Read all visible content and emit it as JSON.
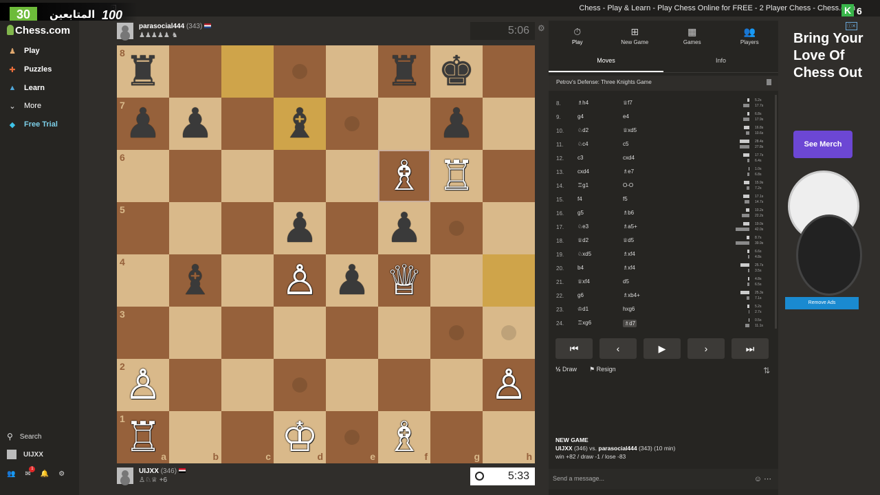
{
  "window": {
    "title": "Chess - Play & Learn - Play Chess Online for FREE - 2 Player Chess - Chess.com"
  },
  "overlay": {
    "count1": "30",
    "text": "المتابعين",
    "count2": "100",
    "k_label": "K",
    "k_num": "6"
  },
  "sidebar": {
    "logo": "Chess.com",
    "items": [
      {
        "label": "Play",
        "icon": "play-icon",
        "color": "#e2a96f"
      },
      {
        "label": "Puzzles",
        "icon": "puzzle-icon",
        "color": "#e86d3a"
      },
      {
        "label": "Learn",
        "icon": "learn-icon",
        "color": "#4fa6d8"
      },
      {
        "label": "More",
        "icon": "chevron-down-icon",
        "color": "#cccccc"
      },
      {
        "label": "Free Trial",
        "icon": "diamond-icon",
        "color": "#3ec3e8"
      }
    ],
    "search_label": "Search",
    "user_label": "UIJXX",
    "notif_count": "1"
  },
  "top_player": {
    "name": "parasocial444",
    "rating": "(343)",
    "material": "♟♟♟♟♟ ♞",
    "clock": "5:06"
  },
  "bottom_player": {
    "name": "UIJXX",
    "rating": "(346)",
    "material": "♙♘♕",
    "advantage": "+6",
    "clock": "5:33"
  },
  "board": {
    "files": [
      "a",
      "b",
      "c",
      "d",
      "e",
      "f",
      "g",
      "h"
    ],
    "ranks": [
      "8",
      "7",
      "6",
      "5",
      "4",
      "3",
      "2",
      "1"
    ],
    "pieces": [
      {
        "sq": "a8",
        "p": "♜",
        "c": "b"
      },
      {
        "sq": "f8",
        "p": "♜",
        "c": "b"
      },
      {
        "sq": "g8",
        "p": "♚",
        "c": "b"
      },
      {
        "sq": "a7",
        "p": "♟",
        "c": "b"
      },
      {
        "sq": "b7",
        "p": "♟",
        "c": "b"
      },
      {
        "sq": "d7",
        "p": "♝",
        "c": "b"
      },
      {
        "sq": "g7",
        "p": "♟",
        "c": "b"
      },
      {
        "sq": "f6",
        "p": "♗",
        "c": "w"
      },
      {
        "sq": "g6",
        "p": "♖",
        "c": "w"
      },
      {
        "sq": "d5",
        "p": "♟",
        "c": "b"
      },
      {
        "sq": "f5",
        "p": "♟",
        "c": "b"
      },
      {
        "sq": "b4",
        "p": "♝",
        "c": "b"
      },
      {
        "sq": "d4",
        "p": "♙",
        "c": "w"
      },
      {
        "sq": "e4",
        "p": "♟",
        "c": "b"
      },
      {
        "sq": "f4",
        "p": "♕",
        "c": "w"
      },
      {
        "sq": "a2",
        "p": "♙",
        "c": "w"
      },
      {
        "sq": "h2",
        "p": "♙",
        "c": "w"
      },
      {
        "sq": "a1",
        "p": "♖",
        "c": "w"
      },
      {
        "sq": "d1",
        "p": "♔",
        "c": "w"
      },
      {
        "sq": "f1",
        "p": "♗",
        "c": "w"
      }
    ],
    "highlights": [
      "c8",
      "d7",
      "h4"
    ],
    "selected": [
      "f6"
    ],
    "hints": [
      "d8",
      "e7",
      "g5",
      "g3",
      "d2",
      "e1",
      "h3"
    ]
  },
  "panel": {
    "tabs": [
      {
        "label": "Play",
        "icon": "stopwatch-icon"
      },
      {
        "label": "New Game",
        "icon": "plus-icon"
      },
      {
        "label": "Games",
        "icon": "grid-icon"
      },
      {
        "label": "Players",
        "icon": "players-icon"
      }
    ],
    "subtabs": [
      "Moves",
      "Info"
    ],
    "opening": "Petrov's Defense: Three Knights Game",
    "moves": [
      {
        "n": "8.",
        "w": "♗h4",
        "b": "♕f7",
        "t1": "5.2s",
        "t2": "17.7s"
      },
      {
        "n": "9.",
        "w": "g4",
        "b": "e4",
        "t1": "6.8s",
        "t2": "17.9s"
      },
      {
        "n": "10.",
        "w": "♘d2",
        "b": "♕xd5",
        "t1": "16.8s",
        "t2": "10.6s"
      },
      {
        "n": "11.",
        "w": "♘c4",
        "b": "c5",
        "t1": "28.4s",
        "t2": "27.8s"
      },
      {
        "n": "12.",
        "w": "c3",
        "b": "cxd4",
        "t1": "17.7s",
        "t2": "6.4s"
      },
      {
        "n": "13.",
        "w": "cxd4",
        "b": "♗e7",
        "t1": "1.0s",
        "t2": "6.8s"
      },
      {
        "n": "14.",
        "w": "♖g1",
        "b": "O-O",
        "t1": "15.9s",
        "t2": "7.2s"
      },
      {
        "n": "15.",
        "w": "f4",
        "b": "f5",
        "t1": "17.1s",
        "t2": "14.7s"
      },
      {
        "n": "16.",
        "w": "g5",
        "b": "♗b6",
        "t1": "10.2s",
        "t2": "22.2s"
      },
      {
        "n": "17.",
        "w": "♘e3",
        "b": "♗a5+",
        "t1": "19.0s",
        "t2": "42.0s"
      },
      {
        "n": "18.",
        "w": "♕d2",
        "b": "♕d5",
        "t1": "8.7s",
        "t2": "39.9s"
      },
      {
        "n": "19.",
        "w": "♘xd5",
        "b": "♗xf4",
        "t1": "6.6s",
        "t2": "4.8s"
      },
      {
        "n": "20.",
        "w": "b4",
        "b": "♗xf4",
        "t1": "25.7s",
        "t2": "3.5s"
      },
      {
        "n": "21.",
        "w": "♕xf4",
        "b": "d5",
        "t1": "4.8s",
        "t2": "6.5s"
      },
      {
        "n": "22.",
        "w": "g6",
        "b": "♗xb4+",
        "t1": "25.3s",
        "t2": "7.1s"
      },
      {
        "n": "23.",
        "w": "♔d1",
        "b": "hxg6",
        "t1": "5.2s",
        "t2": "2.7s"
      },
      {
        "n": "24.",
        "w": "♖xg6",
        "b": "♗d7",
        "t1": "0.5s",
        "t2": "11.1s"
      }
    ],
    "draw_label": "Draw",
    "resign_label": "Resign",
    "new_game_title": "NEW GAME",
    "new_game_line1_a": "UIJXX",
    "new_game_line1_b": " (346) vs. ",
    "new_game_line1_c": "parasocial444",
    "new_game_line1_d": " (343) (10 min)",
    "new_game_line2": "win +82 / draw -1 / lose -83",
    "message_placeholder": "Send a message..."
  },
  "ad": {
    "headline": "Bring Your Love Of Chess Out",
    "button": "See Merch",
    "remove": "Remove Ads"
  }
}
